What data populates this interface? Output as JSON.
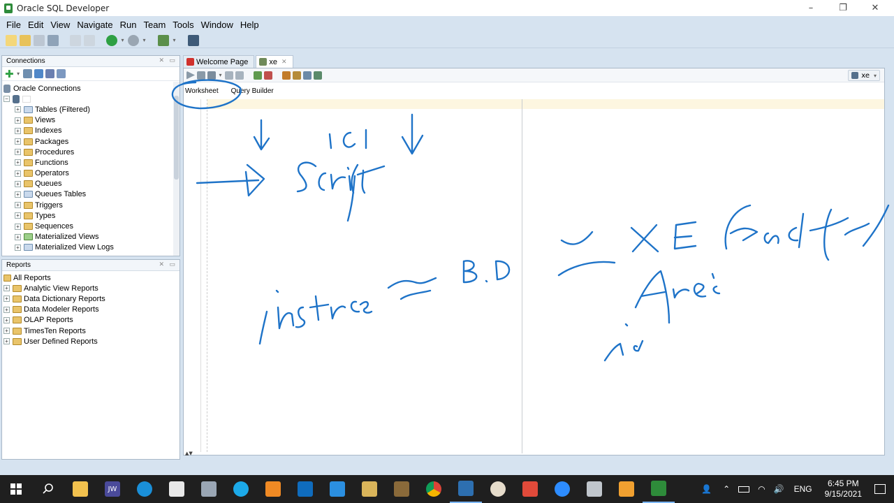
{
  "window": {
    "title": "Oracle SQL Developer"
  },
  "menu": [
    "File",
    "Edit",
    "View",
    "Navigate",
    "Run",
    "Team",
    "Tools",
    "Window",
    "Help"
  ],
  "connections_panel": {
    "title": "Connections",
    "root": "Oracle Connections",
    "items": [
      "Tables (Filtered)",
      "Views",
      "Indexes",
      "Packages",
      "Procedures",
      "Functions",
      "Operators",
      "Queues",
      "Queues Tables",
      "Triggers",
      "Types",
      "Sequences",
      "Materialized Views",
      "Materialized View Logs"
    ]
  },
  "reports_panel": {
    "title": "Reports",
    "root": "All Reports",
    "items": [
      "Analytic View Reports",
      "Data Dictionary Reports",
      "Data Modeler Reports",
      "OLAP Reports",
      "TimesTen Reports",
      "User Defined Reports"
    ]
  },
  "editor": {
    "tabs": [
      "Welcome Page",
      "xe"
    ],
    "subtabs": [
      "Worksheet",
      "Query Builder"
    ],
    "connection": "xe"
  },
  "taskbar": {
    "language": "ENG",
    "time": "6:45 PM",
    "date": "9/15/2021"
  }
}
